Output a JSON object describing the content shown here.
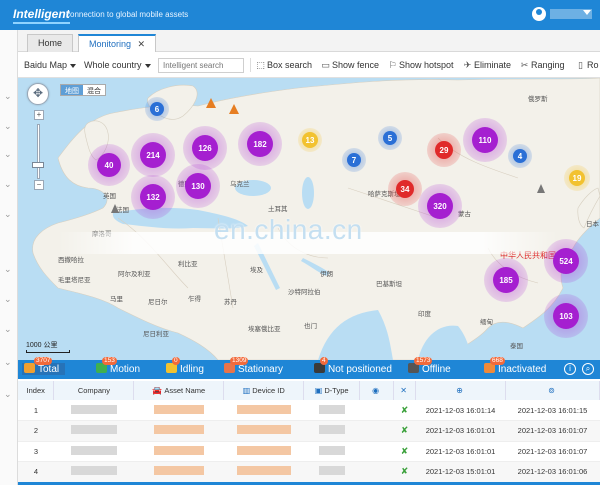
{
  "header": {
    "logo": "Intelligent",
    "tagline": "connection to global mobile assets",
    "user_caret": "▾"
  },
  "tabs": [
    {
      "label": "Home",
      "active": false
    },
    {
      "label": "Monitoring",
      "active": true,
      "close": "✕"
    }
  ],
  "toolbar": {
    "map_source": "Baidu Map",
    "region": "Whole country",
    "search_placeholder": "Intelligent search",
    "box_search": "Box search",
    "show_fence": "Show fence",
    "show_hotspot": "Show hotspot",
    "eliminate": "Eliminate",
    "ranging": "Ranging",
    "more": "Ro"
  },
  "map": {
    "map_type_options": [
      "地图",
      "混合"
    ],
    "selected_map_type": "地图",
    "scale_label": "1000 公里",
    "watermark": "en.china.cn",
    "labels": [
      {
        "text": "英国",
        "color": "#555"
      },
      {
        "text": "法国",
        "color": "#555"
      },
      {
        "text": "德国",
        "color": "#555"
      },
      {
        "text": "乌克兰",
        "color": "#555"
      },
      {
        "text": "土耳其",
        "color": "#555"
      },
      {
        "text": "利比亚",
        "color": "#555"
      },
      {
        "text": "埃及",
        "color": "#555"
      },
      {
        "text": "阿尔及利亚",
        "color": "#555"
      },
      {
        "text": "马里",
        "color": "#555"
      },
      {
        "text": "尼日尔",
        "color": "#555"
      },
      {
        "text": "乍得",
        "color": "#555"
      },
      {
        "text": "苏丹",
        "color": "#555"
      },
      {
        "text": "尼日利亚",
        "color": "#555"
      },
      {
        "text": "沙特阿拉伯",
        "color": "#555"
      },
      {
        "text": "伊朗",
        "color": "#555"
      },
      {
        "text": "印度",
        "color": "#555"
      },
      {
        "text": "巴基斯坦",
        "color": "#555"
      },
      {
        "text": "哈萨克斯坦",
        "color": "#555"
      },
      {
        "text": "蒙古",
        "color": "#555"
      },
      {
        "text": "中华人民共和国",
        "color": "#d22"
      },
      {
        "text": "俄罗斯",
        "color": "#555"
      },
      {
        "text": "也门",
        "color": "#555"
      },
      {
        "text": "埃塞俄比亚",
        "color": "#555"
      },
      {
        "text": "毛里塔尼亚",
        "color": "#555"
      },
      {
        "text": "西撒哈拉",
        "color": "#555"
      },
      {
        "text": "摩洛哥",
        "color": "#555"
      },
      {
        "text": "泰国",
        "color": "#555"
      },
      {
        "text": "缅甸",
        "color": "#555"
      },
      {
        "text": "日本",
        "color": "#555"
      }
    ],
    "clusters": [
      {
        "count": "40",
        "color": "#a51fd0"
      },
      {
        "count": "214",
        "color": "#a51fd0"
      },
      {
        "count": "126",
        "color": "#a51fd0"
      },
      {
        "count": "182",
        "color": "#a51fd0"
      },
      {
        "count": "6",
        "color": "#2a6fd6"
      },
      {
        "count": "13",
        "color": "#f2c230"
      },
      {
        "count": "5",
        "color": "#2a6fd6"
      },
      {
        "count": "7",
        "color": "#2a6fd6"
      },
      {
        "count": "29",
        "color": "#e02a2a"
      },
      {
        "count": "110",
        "color": "#a51fd0"
      },
      {
        "count": "4",
        "color": "#2a6fd6"
      },
      {
        "count": "19",
        "color": "#f2c230"
      },
      {
        "count": "132",
        "color": "#a51fd0"
      },
      {
        "count": "130",
        "color": "#a51fd0"
      },
      {
        "count": "34",
        "color": "#e02a2a"
      },
      {
        "count": "320",
        "color": "#a51fd0"
      },
      {
        "count": "524",
        "color": "#a51fd0"
      },
      {
        "count": "185",
        "color": "#a51fd0"
      },
      {
        "count": "103",
        "color": "#a51fd0"
      }
    ]
  },
  "status_tabs": [
    {
      "label": "Total",
      "badge": "3707",
      "active": true
    },
    {
      "label": "Motion",
      "badge": "153",
      "active": false
    },
    {
      "label": "Idling",
      "badge": "0",
      "active": false
    },
    {
      "label": "Stationary",
      "badge": "1309",
      "active": false
    },
    {
      "label": "Not positioned",
      "badge": "4",
      "active": false
    },
    {
      "label": "Offline",
      "badge": "1573",
      "active": false
    },
    {
      "label": "Inactivated",
      "badge": "668",
      "active": false
    }
  ],
  "status_icons": [
    "info-icon",
    "search-icon"
  ],
  "table": {
    "headers": [
      "Index",
      "Company",
      "Asset Name",
      "Device ID",
      "D-Type",
      "",
      "",
      "",
      ""
    ],
    "rows": [
      {
        "index": "1",
        "t1": "2021-12-03 16:01:14",
        "t2": "2021-12-03 16:01:15"
      },
      {
        "index": "2",
        "t1": "2021-12-03 16:01:01",
        "t2": "2021-12-03 16:01:07"
      },
      {
        "index": "3",
        "t1": "2021-12-03 16:01:01",
        "t2": "2021-12-03 16:01:07"
      },
      {
        "index": "4",
        "t1": "2021-12-03 15:01:01",
        "t2": "2021-12-03 16:01:06"
      }
    ]
  },
  "colors": {
    "brand": "#1f86d6",
    "purple_cluster": "#a51fd0",
    "red_cluster": "#e02a2a",
    "blue_cluster": "#2a6fd6",
    "yellow_cluster": "#f2c230"
  }
}
